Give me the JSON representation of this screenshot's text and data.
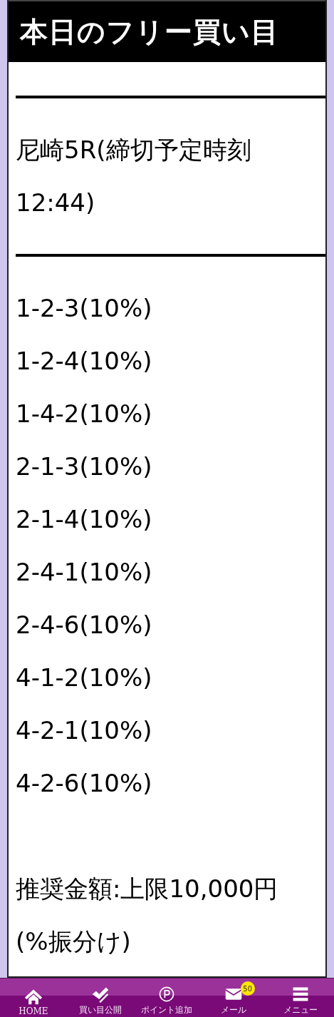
{
  "header": {
    "title": "本日のフリー買い目"
  },
  "race": "尼崎5R(締切予定時刻12:44)",
  "picks": [
    "1-2-3(10%)",
    "1-2-4(10%)",
    "1-4-2(10%)",
    "2-1-3(10%)",
    "2-1-4(10%)",
    "2-4-1(10%)",
    "2-4-6(10%)",
    "4-1-2(10%)",
    "4-2-1(10%)",
    "4-2-6(10%)"
  ],
  "recommendation": "推奨金額:上限10,000円(%振分け)",
  "nav": [
    {
      "kind": "home",
      "label": "HOME"
    },
    {
      "kind": "check",
      "label": "買い目公開"
    },
    {
      "kind": "point",
      "label": "ポイント追加"
    },
    {
      "kind": "mail",
      "label": "メール",
      "badge": "50"
    },
    {
      "kind": "menu",
      "label": "メニュー"
    }
  ]
}
